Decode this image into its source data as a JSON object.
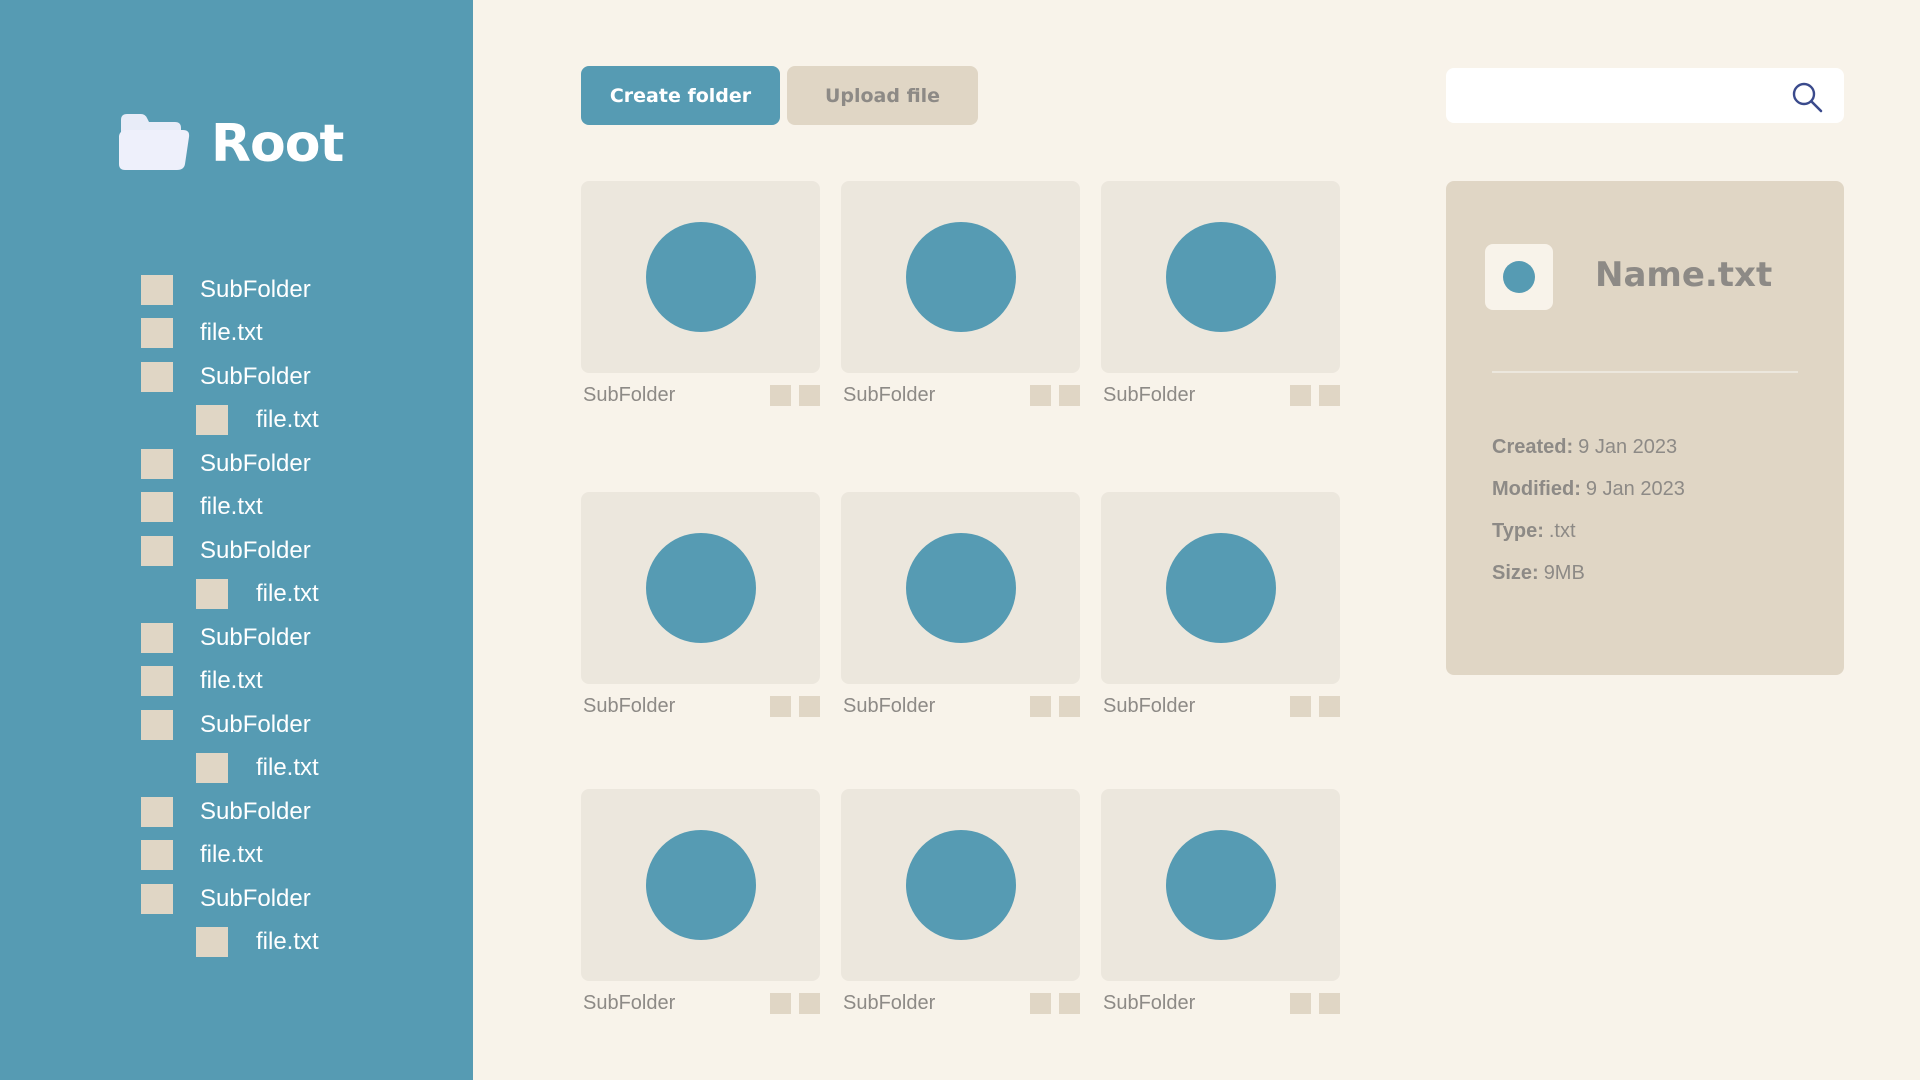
{
  "sidebar": {
    "title": "Root",
    "items": [
      {
        "label": "SubFolder",
        "indent": false
      },
      {
        "label": "file.txt",
        "indent": false
      },
      {
        "label": "SubFolder",
        "indent": false
      },
      {
        "label": "file.txt",
        "indent": true
      },
      {
        "label": "SubFolder",
        "indent": false
      },
      {
        "label": "file.txt",
        "indent": false
      },
      {
        "label": "SubFolder",
        "indent": false
      },
      {
        "label": "file.txt",
        "indent": true
      },
      {
        "label": "SubFolder",
        "indent": false
      },
      {
        "label": "file.txt",
        "indent": false
      },
      {
        "label": "SubFolder",
        "indent": false
      },
      {
        "label": "file.txt",
        "indent": true
      },
      {
        "label": "SubFolder",
        "indent": false
      },
      {
        "label": "file.txt",
        "indent": false
      },
      {
        "label": "SubFolder",
        "indent": false
      },
      {
        "label": "file.txt",
        "indent": true
      }
    ]
  },
  "toolbar": {
    "create_label": "Create folder",
    "upload_label": "Upload file"
  },
  "search": {
    "value": "",
    "placeholder": ""
  },
  "grid": {
    "cards": [
      {
        "label": "SubFolder"
      },
      {
        "label": "SubFolder"
      },
      {
        "label": "SubFolder"
      },
      {
        "label": "SubFolder"
      },
      {
        "label": "SubFolder"
      },
      {
        "label": "SubFolder"
      },
      {
        "label": "SubFolder"
      },
      {
        "label": "SubFolder"
      },
      {
        "label": "SubFolder"
      }
    ]
  },
  "details": {
    "name": "Name.txt",
    "meta": [
      {
        "key": "Created:",
        "value": "9 Jan 2023"
      },
      {
        "key": "Modified:",
        "value": "9 Jan 2023"
      },
      {
        "key": "Type:",
        "value": ".txt"
      },
      {
        "key": "Size:",
        "value": "9MB"
      }
    ]
  },
  "colors": {
    "accent": "#569bb3",
    "background": "#f8f3ea",
    "tan": "#e0d6c5",
    "card": "#ece7dd",
    "muted_text": "#8d8a86",
    "search_icon": "#3a4a8c"
  },
  "icons": {
    "root": "folder-open-icon",
    "search": "search-icon"
  }
}
